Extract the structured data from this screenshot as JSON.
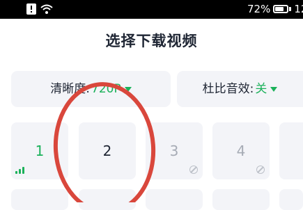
{
  "status_bar": {
    "battery_percent_text": "72%",
    "battery_level": 0.72,
    "time_partial": "12",
    "icons": [
      "notification-icon",
      "wifi-icon",
      "battery-icon"
    ]
  },
  "header": {
    "title": "选择下载视频"
  },
  "options": {
    "quality": {
      "label": "清晰度:",
      "value": "720P"
    },
    "dolby": {
      "label": "杜比音效:",
      "value": "关"
    }
  },
  "episodes": [
    {
      "number": "1",
      "state": "downloaded"
    },
    {
      "number": "2",
      "state": "selected"
    },
    {
      "number": "3",
      "state": "disabled"
    },
    {
      "number": "4",
      "state": "disabled"
    },
    {
      "number": "",
      "state": "partial"
    }
  ],
  "colors": {
    "accent": "#1bb15a",
    "tile_bg": "#f3f4f8",
    "annotation": "#d9473c",
    "disabled_text": "#a6abb5"
  }
}
